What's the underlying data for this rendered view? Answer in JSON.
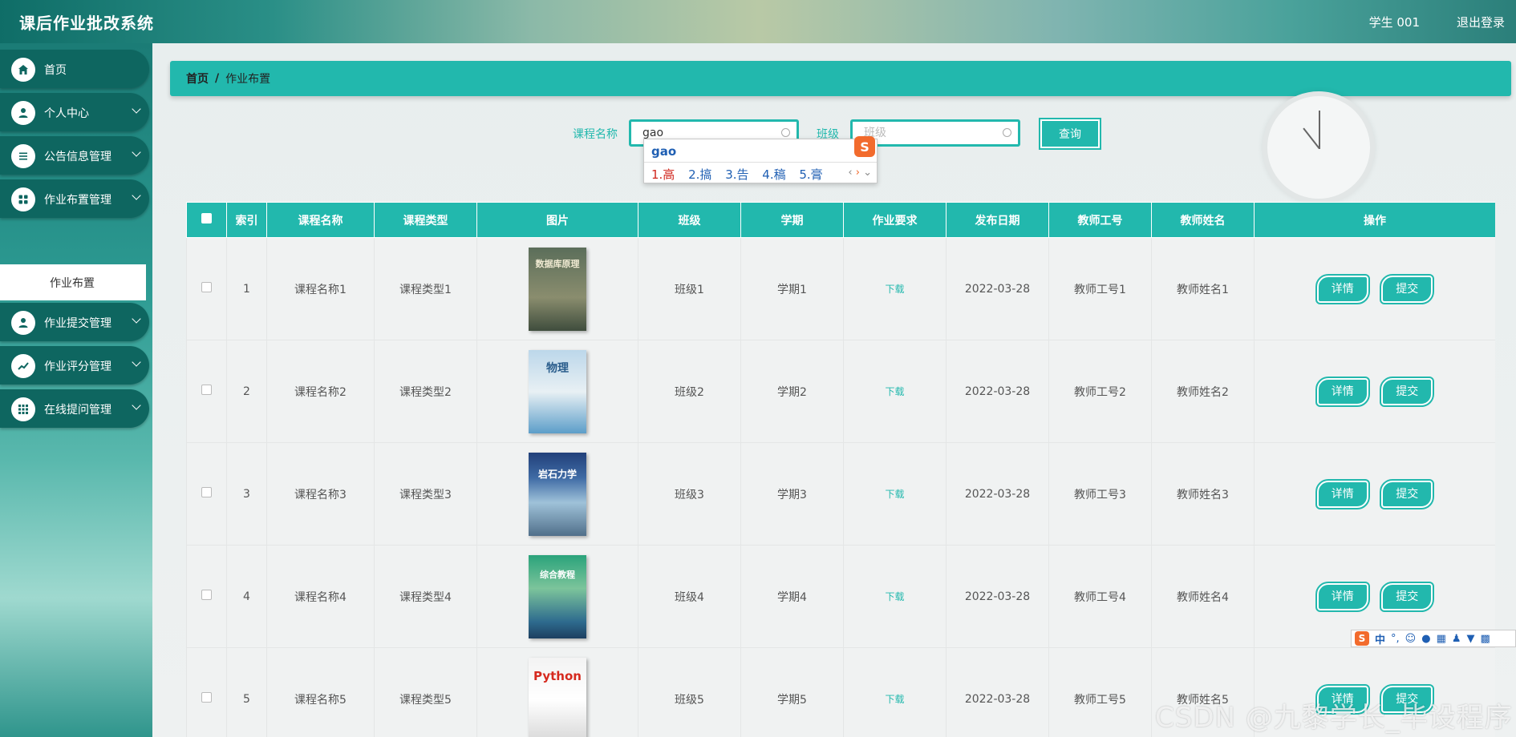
{
  "header": {
    "app_title": "课后作业批改系统",
    "user_name": "学生 001",
    "logout_label": "退出登录"
  },
  "sidebar": {
    "items": [
      {
        "label": "首页",
        "icon": "home-icon"
      },
      {
        "label": "个人中心",
        "icon": "user-icon"
      },
      {
        "label": "公告信息管理",
        "icon": "list-icon"
      },
      {
        "label": "作业布置管理",
        "icon": "grid-icon"
      },
      {
        "label": "作业提交管理",
        "icon": "user-icon"
      },
      {
        "label": "作业评分管理",
        "icon": "chart-icon"
      },
      {
        "label": "在线提问管理",
        "icon": "apps-icon"
      }
    ],
    "submenu_label": "作业布置"
  },
  "breadcrumb": {
    "home": "首页",
    "separator": "/",
    "current": "作业布置"
  },
  "search": {
    "course_label": "课程名称",
    "course_value": "gao",
    "class_label": "班级",
    "class_placeholder": "班级",
    "query_label": "查询"
  },
  "ime": {
    "pinyin": "gao",
    "candidates": [
      "1.高",
      "2.搞",
      "3.告",
      "4.稿",
      "5.膏"
    ],
    "logo": "S",
    "toolbar": {
      "logo": "S",
      "mode": "中",
      "punct": "°,"
    }
  },
  "table": {
    "columns": [
      "索引",
      "课程名称",
      "课程类型",
      "图片",
      "班级",
      "学期",
      "作业要求",
      "发布日期",
      "教师工号",
      "教师姓名",
      "操作"
    ],
    "rows": [
      {
        "index": "1",
        "course_name": "课程名称1",
        "course_type": "课程类型1",
        "book_title": "数据库原理",
        "class": "班级1",
        "term": "学期1",
        "requirement": "下载",
        "date": "2022-03-28",
        "teacher_id": "教师工号1",
        "teacher_name": "教师姓名1"
      },
      {
        "index": "2",
        "course_name": "课程名称2",
        "course_type": "课程类型2",
        "book_title": "物理",
        "class": "班级2",
        "term": "学期2",
        "requirement": "下载",
        "date": "2022-03-28",
        "teacher_id": "教师工号2",
        "teacher_name": "教师姓名2"
      },
      {
        "index": "3",
        "course_name": "课程名称3",
        "course_type": "课程类型3",
        "book_title": "岩石力学",
        "class": "班级3",
        "term": "学期3",
        "requirement": "下载",
        "date": "2022-03-28",
        "teacher_id": "教师工号3",
        "teacher_name": "教师姓名3"
      },
      {
        "index": "4",
        "course_name": "课程名称4",
        "course_type": "课程类型4",
        "book_title": "综合教程",
        "class": "班级4",
        "term": "学期4",
        "requirement": "下载",
        "date": "2022-03-28",
        "teacher_id": "教师工号4",
        "teacher_name": "教师姓名4"
      },
      {
        "index": "5",
        "course_name": "课程名称5",
        "course_type": "课程类型5",
        "book_title": "Python",
        "class": "班级5",
        "term": "学期5",
        "requirement": "下载",
        "date": "2022-03-28",
        "teacher_id": "教师工号5",
        "teacher_name": "教师姓名5"
      }
    ],
    "detail_label": "详情",
    "submit_label": "提交"
  },
  "watermark": "CSDN @九黎学长_毕设程序",
  "colors": {
    "accent": "#22b8ad",
    "sidebar": "#0e6660",
    "ime_logo": "#f26b2d"
  }
}
